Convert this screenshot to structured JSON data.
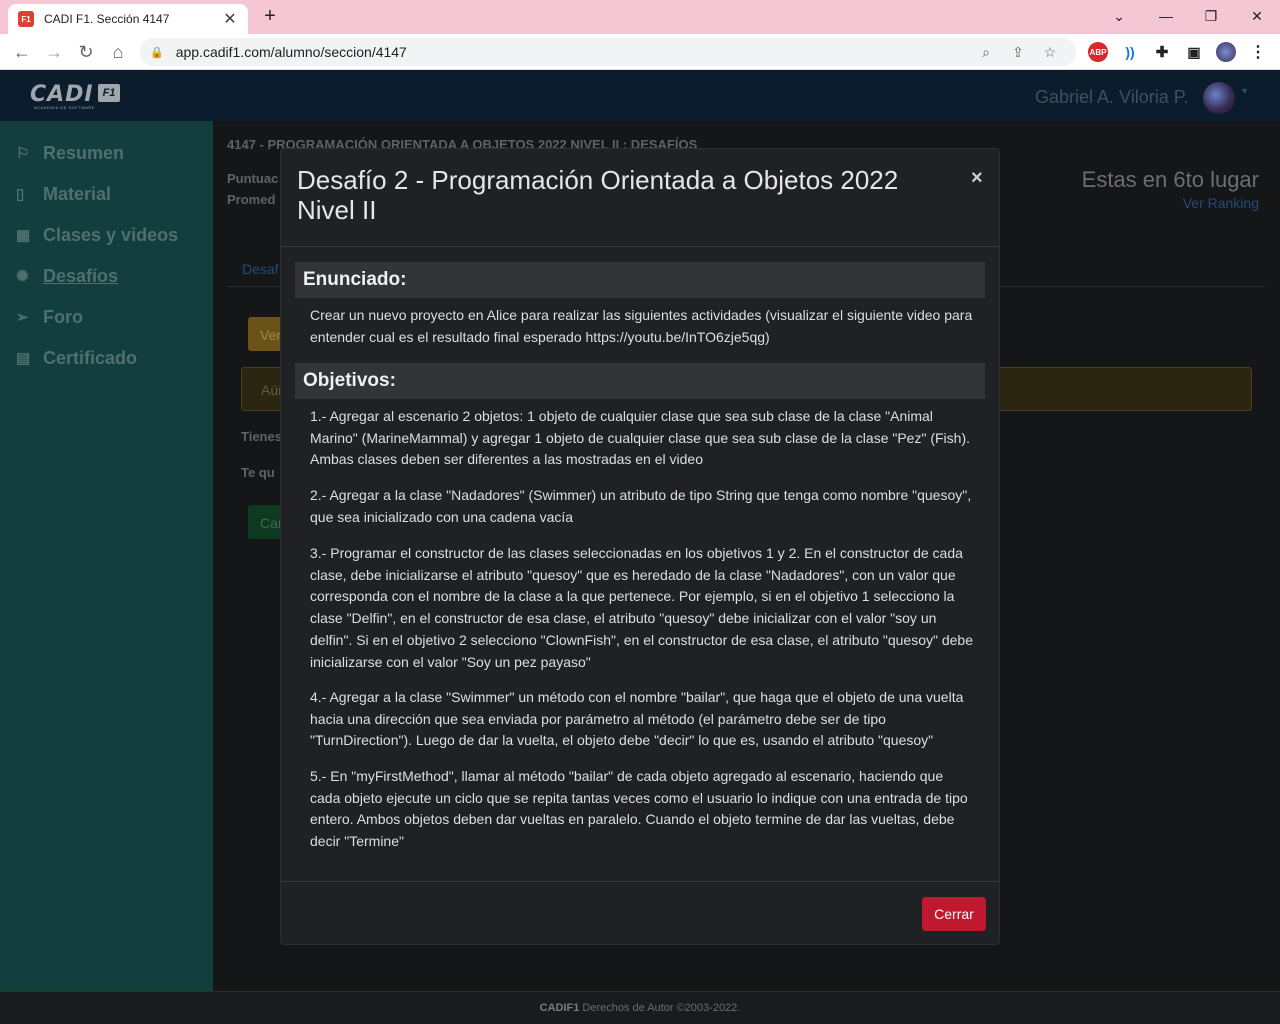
{
  "browser": {
    "tab_favicon": "F1",
    "tab_title": "CADI F1. Sección 4147",
    "tab_close": "✕",
    "new_tab": "+",
    "url": "app.cadif1.com/alumno/seccion/4147",
    "ext_abp": "ABP"
  },
  "app": {
    "logo_text": "CADI",
    "logo_badge": "F1",
    "logo_subtitle": "ACADEMIA DE SOFTWARE",
    "user_name": "Gabriel A. Viloria P."
  },
  "sidebar": {
    "items": [
      {
        "label": "Resumen",
        "icon": "flag-icon"
      },
      {
        "label": "Material",
        "icon": "book-icon"
      },
      {
        "label": "Clases y videos",
        "icon": "calendar-icon"
      },
      {
        "label": "Desafíos",
        "icon": "brain-icon"
      },
      {
        "label": "Foro",
        "icon": "paper-plane-icon"
      },
      {
        "label": "Certificado",
        "icon": "certificate-icon"
      }
    ]
  },
  "main": {
    "title": "4147 - PROGRAMACIÓN ORIENTADA A OBJETOS 2022 NIVEL II : DESAFÍOS",
    "puntuacion_partial": "Puntuac",
    "promedio_partial": "Promed",
    "rank_text": "Estas en 6to lugar",
    "rank_link": "Ver Ranking",
    "tab_partial": "Desafí",
    "button_yellow_partial": "Ver",
    "alert_partial": "Aún",
    "tienes_partial": "Tienes",
    "te_partial": "Te qu",
    "button_green_partial": "Car"
  },
  "modal": {
    "title": "Desafío 2 - Programación Orientada a Objetos 2022 Nivel II",
    "close_symbol": "×",
    "section1_heading": "Enunciado:",
    "section1_text": "Crear un nuevo proyecto en Alice para realizar las siguientes actividades (visualizar el siguiente video para entender cual es el resultado final esperado https://youtu.be/InTO6zje5qg)",
    "section2_heading": "Objetivos:",
    "objectives": [
      "1.- Agregar al escenario 2 objetos: 1 objeto de cualquier clase que sea sub clase de la clase \"Animal Marino\" (MarineMammal) y agregar 1 objeto de cualquier clase que sea sub clase de la clase \"Pez\" (Fish). Ambas clases deben ser diferentes a las mostradas en el video",
      "2.- Agregar a la clase \"Nadadores\" (Swimmer) un atributo de tipo String que tenga como nombre \"quesoy\", que sea inicializado con una cadena vacía",
      "3.- Programar el constructor de las clases seleccionadas en los objetivos 1 y 2. En el constructor de cada clase, debe inicializarse el atributo \"quesoy\" que es heredado de la clase \"Nadadores\", con un valor que corresponda con el nombre de la clase a la que pertenece. Por ejemplo, si en el objetivo 1 selecciono la clase \"Delfin\", en el constructor de esa clase, el atributo \"quesoy\" debe inicializar con el valor \"soy un delfin\". Si en el objetivo 2 selecciono \"ClownFish\", en el constructor de esa clase, el atributo \"quesoy\" debe inicializarse con el valor \"Soy un pez payaso\"",
      "4.- Agregar a la clase \"Swimmer\" un método con el nombre \"bailar\", que haga que el objeto de una vuelta hacia una dirección que sea enviada por parámetro al método (el parámetro debe ser de tipo \"TurnDirection\"). Luego de dar la vuelta, el objeto debe \"decir\" lo que es, usando el atributo \"quesoy\"",
      "5.- En \"myFirstMethod\", llamar al método \"bailar\" de cada objeto agregado al escenario, haciendo que cada objeto ejecute un ciclo que se repita tantas veces como el usuario lo indique con una entrada de tipo entero. Ambos objetos deben dar vueltas en paralelo. Cuando el objeto termine de dar las vueltas, debe decir \"Termine\""
    ],
    "close_button": "Cerrar"
  },
  "footer": {
    "brand": "CADIF1",
    "text": " Derechos de Autor ©2003-2022."
  },
  "colors": {
    "sidebar_bg": "#123e3d",
    "header_bg": "#0b1c2c",
    "modal_bg": "#202124",
    "close_button": "#c0182e"
  }
}
